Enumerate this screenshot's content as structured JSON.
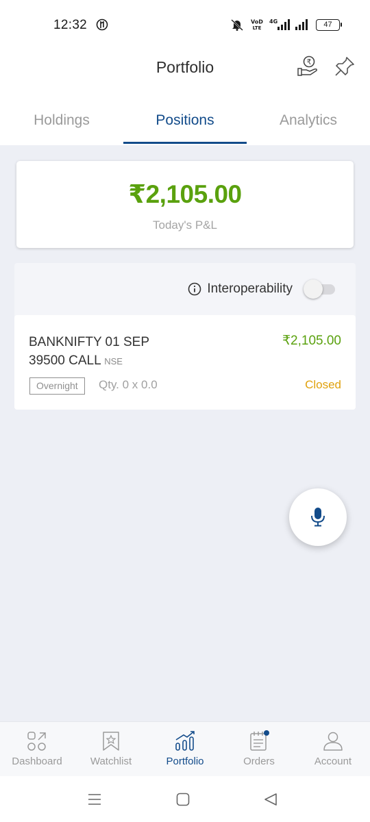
{
  "status_bar": {
    "time": "12:32",
    "network_label": "VoLTE",
    "network_type": "4G",
    "battery": "47"
  },
  "header": {
    "title": "Portfolio"
  },
  "tabs": [
    {
      "label": "Holdings",
      "active": false
    },
    {
      "label": "Positions",
      "active": true
    },
    {
      "label": "Analytics",
      "active": false
    }
  ],
  "pnl": {
    "value": "₹2,105.00",
    "label": "Today's P&L"
  },
  "interop": {
    "label": "Interoperability",
    "enabled": false
  },
  "position": {
    "symbol_line1": "BANKNIFTY 01 SEP",
    "symbol_line2": "39500 CALL",
    "exchange": "NSE",
    "pnl": "₹2,105.00",
    "product_tag": "Overnight",
    "qty": "Qty. 0 x 0.0",
    "status": "Closed"
  },
  "bottom_nav": [
    {
      "label": "Dashboard",
      "icon": "dashboard-icon",
      "active": false
    },
    {
      "label": "Watchlist",
      "icon": "watchlist-icon",
      "active": false
    },
    {
      "label": "Portfolio",
      "icon": "portfolio-icon",
      "active": true
    },
    {
      "label": "Orders",
      "icon": "orders-icon",
      "active": false
    },
    {
      "label": "Account",
      "icon": "account-icon",
      "active": false
    }
  ],
  "colors": {
    "accent": "#124b8a",
    "profit": "#5aa10e",
    "status_closed": "#e0a10c",
    "background": "#edeff5"
  }
}
